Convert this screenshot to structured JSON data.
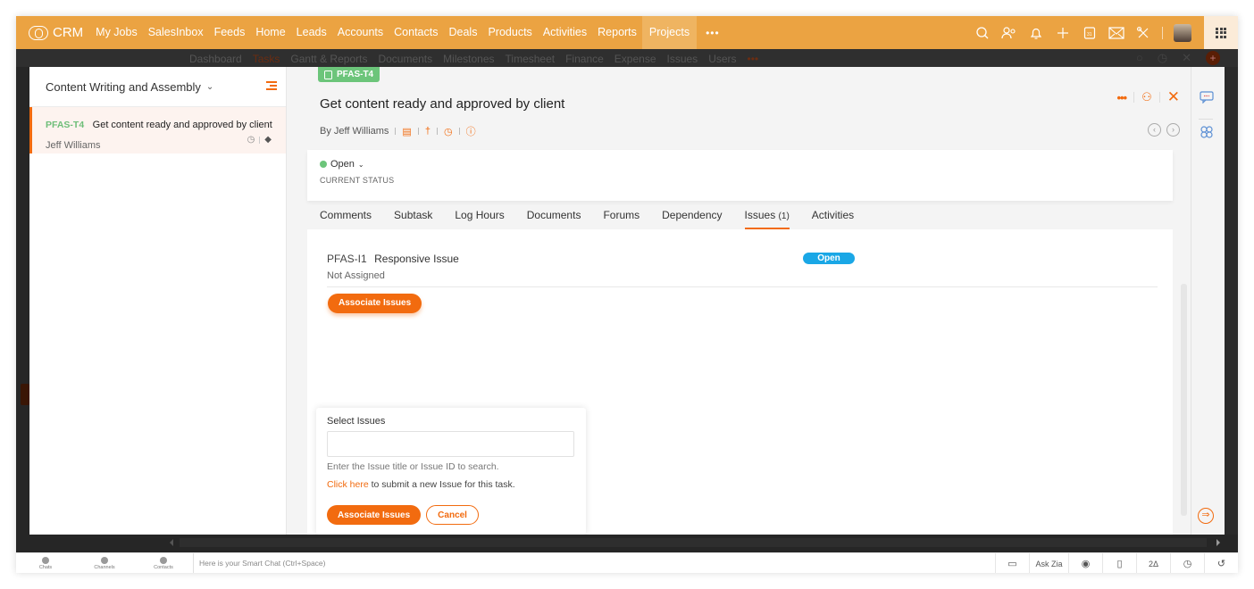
{
  "app": {
    "logo_text": "CRM",
    "nav_items": [
      {
        "label": "My Jobs",
        "active": false
      },
      {
        "label": "SalesInbox",
        "active": false
      },
      {
        "label": "Feeds",
        "active": false
      },
      {
        "label": "Home",
        "active": false
      },
      {
        "label": "Leads",
        "active": false
      },
      {
        "label": "Accounts",
        "active": false
      },
      {
        "label": "Contacts",
        "active": false
      },
      {
        "label": "Deals",
        "active": false
      },
      {
        "label": "Products",
        "active": false
      },
      {
        "label": "Activities",
        "active": false
      },
      {
        "label": "Reports",
        "active": false
      },
      {
        "label": "Projects",
        "active": true
      }
    ],
    "nav_more": "•••",
    "top_icons": [
      "search-icon",
      "contacts-icon",
      "bell-icon",
      "plus-icon",
      "calendar-icon",
      "mail-icon",
      "tools-icon"
    ],
    "colors": {
      "topbar": "#eba342",
      "accent": "#f26b0f",
      "green": "#6cc57a",
      "blue_pill": "#1aa7e6"
    }
  },
  "subnav": {
    "items": [
      "Dashboard",
      "Tasks",
      "Gantt & Reports",
      "Documents",
      "Milestones",
      "Timesheet",
      "Finance",
      "Expense",
      "Issues",
      "Users"
    ],
    "active": "Tasks",
    "more": "•••"
  },
  "list_panel": {
    "title": "Content Writing and Assembly",
    "items": [
      {
        "id": "PFAS-T4",
        "name": "Get content ready and approved by client",
        "owner": "Jeff Williams"
      }
    ]
  },
  "task": {
    "badge": "PFAS-T4",
    "title": "Get content ready and approved by client",
    "by": "By Jeff Williams",
    "status": "Open",
    "status_label": "CURRENT STATUS",
    "tabs": [
      {
        "label": "Comments"
      },
      {
        "label": "Subtask"
      },
      {
        "label": "Log Hours"
      },
      {
        "label": "Documents"
      },
      {
        "label": "Forums"
      },
      {
        "label": "Dependency"
      },
      {
        "label": "Issues",
        "count": "(1)",
        "active": true
      },
      {
        "label": "Activities"
      }
    ],
    "issues": [
      {
        "id": "PFAS-I1",
        "title": "Responsive Issue",
        "assignee": "Not Assigned",
        "status": "Open"
      }
    ],
    "associate_button": "Associate Issues"
  },
  "popup": {
    "label": "Select Issues",
    "input_value": "",
    "input_placeholder": "",
    "help": "Enter the Issue title or Issue ID to search.",
    "link_text": "Click here",
    "link_suffix": " to submit a new Issue for this task.",
    "primary_button": "Associate Issues",
    "cancel_button": "Cancel"
  },
  "bottombar": {
    "items": [
      "Chats",
      "Channels",
      "Contacts"
    ],
    "chat_placeholder": "Here is your Smart Chat (Ctrl+Space)",
    "ask_zia": "Ask Zia"
  }
}
